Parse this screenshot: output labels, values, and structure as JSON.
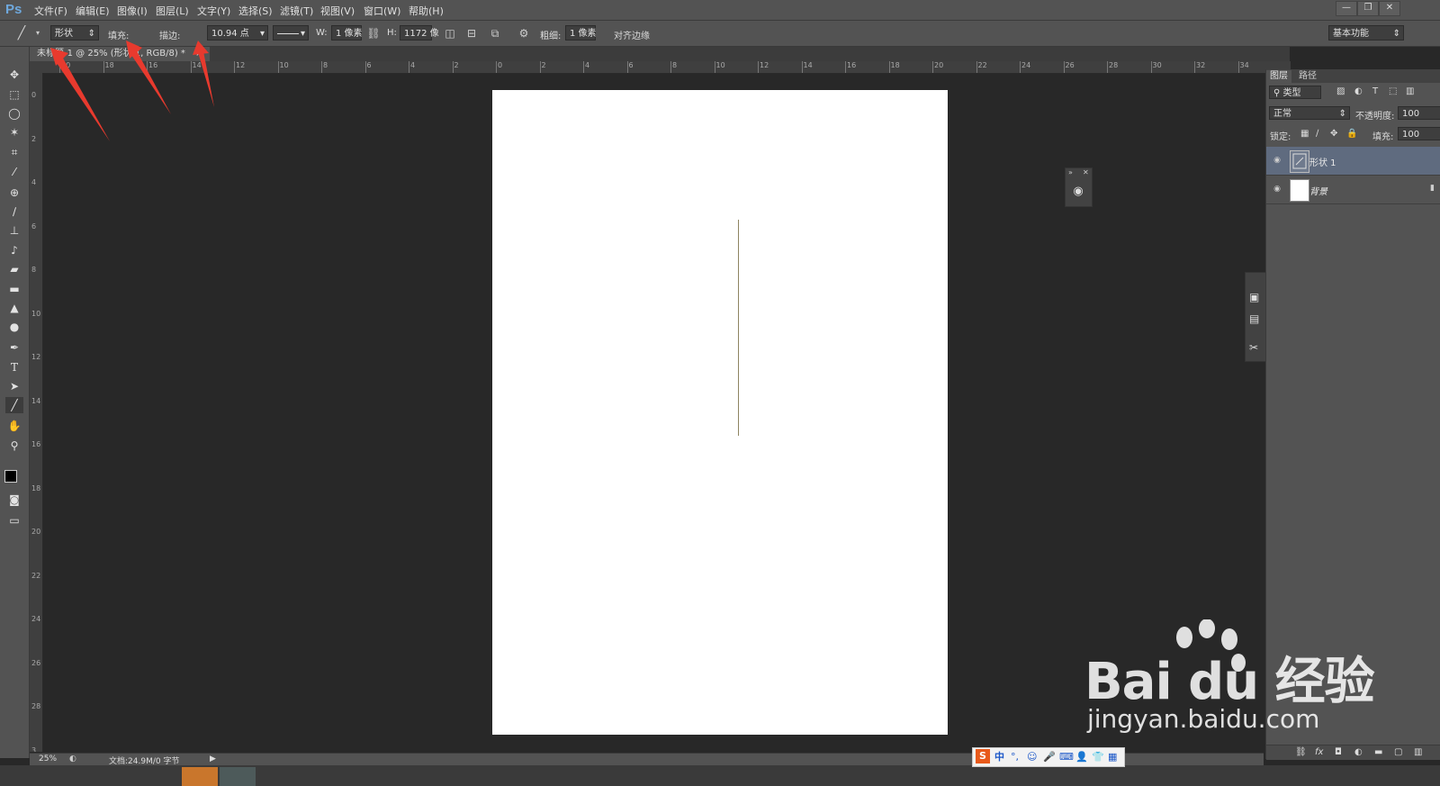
{
  "app": {
    "logo": "Ps",
    "menus": [
      "文件(F)",
      "编辑(E)",
      "图像(I)",
      "图层(L)",
      "文字(Y)",
      "选择(S)",
      "滤镜(T)",
      "视图(V)",
      "窗口(W)",
      "帮助(H)"
    ],
    "window_buttons": [
      "—",
      "❐",
      "✕"
    ]
  },
  "options": {
    "mode": "形状",
    "fill_label": "填充:",
    "fill_color": "#ffff00",
    "stroke_label": "描边:",
    "stroke_width": "10.94 点",
    "w_label": "W:",
    "w_value": "1 像素",
    "h_label": "H:",
    "h_value": "1172 像",
    "weight_label": "粗细:",
    "weight_value": "1 像素",
    "align_edges_label": "对齐边缘",
    "workspace": "基本功能"
  },
  "document": {
    "tab_title": "未标题-1 @ 25% (形状 1, RGB/8) *",
    "close": "×"
  },
  "ruler": {
    "top_labels": [
      "20",
      "18",
      "16",
      "14",
      "12",
      "10",
      "8",
      "6",
      "4",
      "2",
      "0",
      "2",
      "4",
      "6",
      "8",
      "10",
      "12",
      "14",
      "16",
      "18",
      "20",
      "22",
      "24",
      "26",
      "28",
      "30",
      "32",
      "34"
    ],
    "left_labels": [
      "0",
      "2",
      "4",
      "6",
      "8",
      "10",
      "12",
      "14",
      "16",
      "18",
      "20",
      "22",
      "24",
      "26",
      "28",
      "3"
    ]
  },
  "layers_panel": {
    "tabs": [
      "图层",
      "路径"
    ],
    "filter_kind": "类型",
    "blend_mode": "正常",
    "opacity_label": "不透明度:",
    "opacity_value": "100",
    "lock_label": "锁定:",
    "fill_label": "填充:",
    "fill_value": "100",
    "layers": [
      {
        "name": "形状 1",
        "selected": true
      },
      {
        "name": "背景",
        "selected": false
      }
    ]
  },
  "status": {
    "zoom": "25%",
    "doc_info": "文档:24.9M/0 字节"
  },
  "ime": {
    "logo": "S",
    "items": [
      "中",
      "°,",
      "☺",
      "🎤",
      "⌨",
      "👤",
      "👕",
      "▦"
    ]
  },
  "watermark": {
    "brand": "Bai du 经验",
    "url": "jingyan.baidu.com"
  },
  "colors": {
    "accent_arrow": "#e83a2e",
    "line_color": "#8e8460",
    "selected_layer": "#5f6b7f"
  }
}
